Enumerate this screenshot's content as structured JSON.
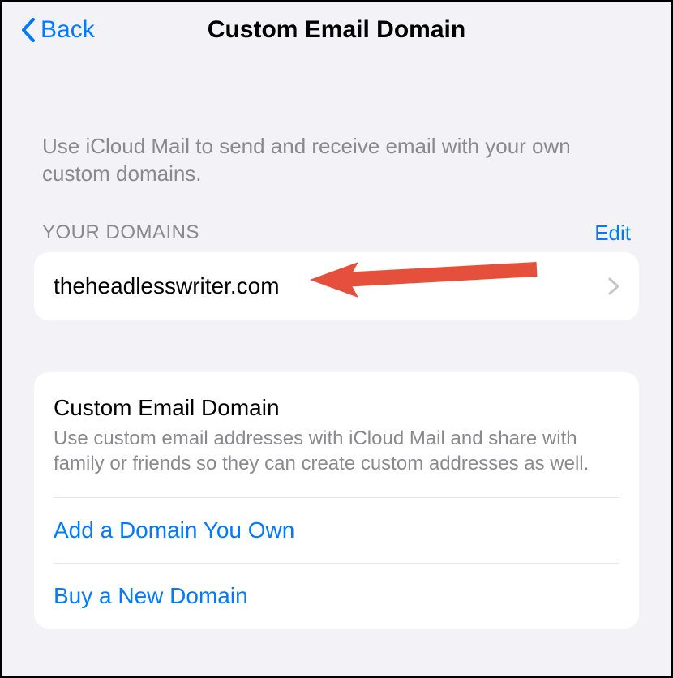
{
  "header": {
    "back_label": "Back",
    "title": "Custom Email Domain"
  },
  "intro_text": "Use iCloud Mail to send and receive email with your own custom domains.",
  "domains": {
    "section_label": "YOUR DOMAINS",
    "edit_label": "Edit",
    "items": [
      {
        "name": "theheadlesswriter.com"
      }
    ]
  },
  "info": {
    "title": "Custom Email Domain",
    "description": "Use custom email addresses with iCloud Mail and share with family or friends so they can create custom addresses as well.",
    "options": [
      {
        "label": "Add a Domain You Own"
      },
      {
        "label": "Buy a New Domain"
      }
    ]
  },
  "annotation": {
    "arrow_color": "#e74c3c"
  }
}
